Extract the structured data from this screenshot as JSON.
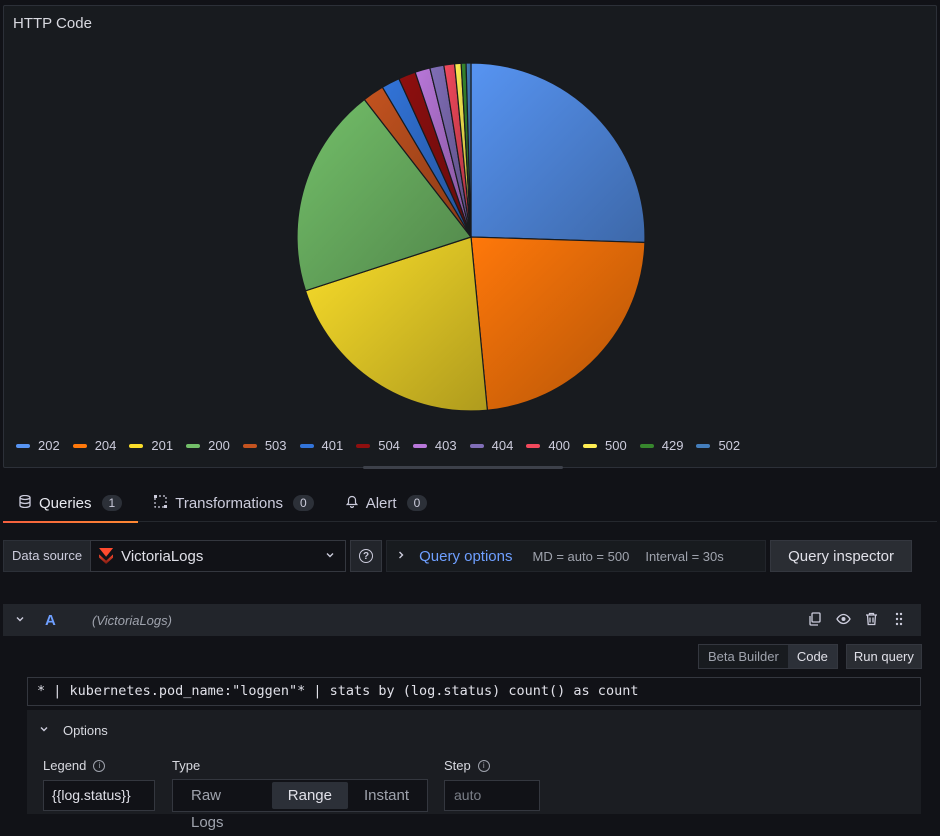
{
  "panel": {
    "title": "HTTP Code"
  },
  "chart_data": {
    "type": "pie",
    "title": "HTTP Code",
    "legend_position": "bottom",
    "slices": [
      {
        "label": "202",
        "value": 25.5,
        "color": "#5794f2"
      },
      {
        "label": "204",
        "value": 23.0,
        "color": "#ff780a"
      },
      {
        "label": "201",
        "value": 21.5,
        "color": "#fade2a"
      },
      {
        "label": "200",
        "value": 19.5,
        "color": "#73bf69"
      },
      {
        "label": "503",
        "value": 2.0,
        "color": "#c4531f"
      },
      {
        "label": "401",
        "value": 1.7,
        "color": "#3274d9"
      },
      {
        "label": "504",
        "value": 1.6,
        "color": "#8f0f0f"
      },
      {
        "label": "403",
        "value": 1.4,
        "color": "#b877d9"
      },
      {
        "label": "404",
        "value": 1.3,
        "color": "#806eb7"
      },
      {
        "label": "400",
        "value": 1.0,
        "color": "#f2495c"
      },
      {
        "label": "500",
        "value": 0.6,
        "color": "#ffee52"
      },
      {
        "label": "429",
        "value": 0.45,
        "color": "#37872d"
      },
      {
        "label": "502",
        "value": 0.45,
        "color": "#447ebc"
      }
    ]
  },
  "tabs": [
    {
      "label": "Queries",
      "count": "1",
      "icon": "database-icon"
    },
    {
      "label": "Transformations",
      "count": "0",
      "icon": "transform-icon"
    },
    {
      "label": "Alert",
      "count": "0",
      "icon": "bell-icon"
    }
  ],
  "datasource": {
    "label": "Data source",
    "selected": "VictoriaLogs",
    "query_options_label": "Query options",
    "md": "MD = auto = 500",
    "interval": "Interval = 30s",
    "inspector_label": "Query inspector"
  },
  "query": {
    "ref_id": "A",
    "datasource_name": "(VictoriaLogs)",
    "mode_builder": "Beta Builder",
    "mode_code": "Code",
    "run_label": "Run query",
    "expr": "* | kubernetes.pod_name:\"loggen\"* | stats by (log.status) count() as count"
  },
  "options": {
    "title": "Options",
    "legend_label": "Legend",
    "legend_value": "{{log.status}}",
    "type_label": "Type",
    "types": [
      "Raw Logs",
      "Range",
      "Instant"
    ],
    "type_selected": "Range",
    "step_label": "Step",
    "step_placeholder": "auto"
  }
}
